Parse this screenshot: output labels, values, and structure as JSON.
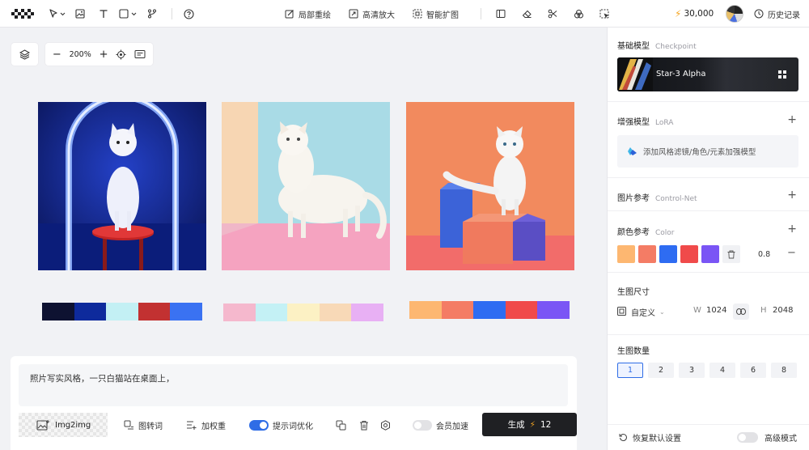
{
  "topbar": {
    "center_tools": [
      {
        "label": "局部重绘",
        "icon": "repaint-icon"
      },
      {
        "label": "高清放大",
        "icon": "upscale-icon"
      },
      {
        "label": "智能扩图",
        "icon": "expand-icon"
      }
    ],
    "credits": "30,000",
    "history_label": "历史记录"
  },
  "canvas": {
    "zoom": "200%",
    "palettes": [
      [
        "#0e1231",
        "#0e2a9c",
        "#c3f0f4",
        "#c23131",
        "#3a72f2"
      ],
      [
        "#f5b8cd",
        "#c4f1f5",
        "#fcf1c4",
        "#f8d9b7",
        "#e8b0f4"
      ],
      [
        "#fdb771",
        "#f47c65",
        "#2e6cf2",
        "#f04a4a",
        "#7a55f5"
      ]
    ]
  },
  "prompt": {
    "text": "照片写实风格，一只白猫站在桌面上，",
    "img2img_label": "Img2img",
    "tools": {
      "image_to_prompt": "图转词",
      "add_weight": "加权重",
      "prompt_optimize": "提示词优化",
      "member_speed": "会员加速"
    },
    "generate_label": "生成",
    "generate_cost": "12"
  },
  "panel": {
    "base_model": {
      "title": "基础模型",
      "en": "Checkpoint",
      "name": "Star-3 Alpha"
    },
    "lora": {
      "title": "增强模型",
      "en": "LoRA",
      "placeholder": "添加风格滤镜/角色/元素加强模型"
    },
    "controlnet": {
      "title": "图片参考",
      "en": "Control-Net"
    },
    "color": {
      "title": "颜色参考",
      "en": "Color",
      "swatches": [
        "#fdb771",
        "#f47c65",
        "#2e6cf2",
        "#f04a4a",
        "#7a55f5"
      ],
      "weight": "0.8"
    },
    "size": {
      "title": "生图尺寸",
      "ratio": "自定义",
      "w_label": "W",
      "w": "1024",
      "h_label": "H",
      "h": "2048"
    },
    "count": {
      "title": "生图数量",
      "options": [
        "1",
        "2",
        "3",
        "4",
        "6",
        "8"
      ],
      "selected": "1"
    },
    "footer": {
      "reset": "恢复默认设置",
      "advanced": "高级模式"
    }
  }
}
